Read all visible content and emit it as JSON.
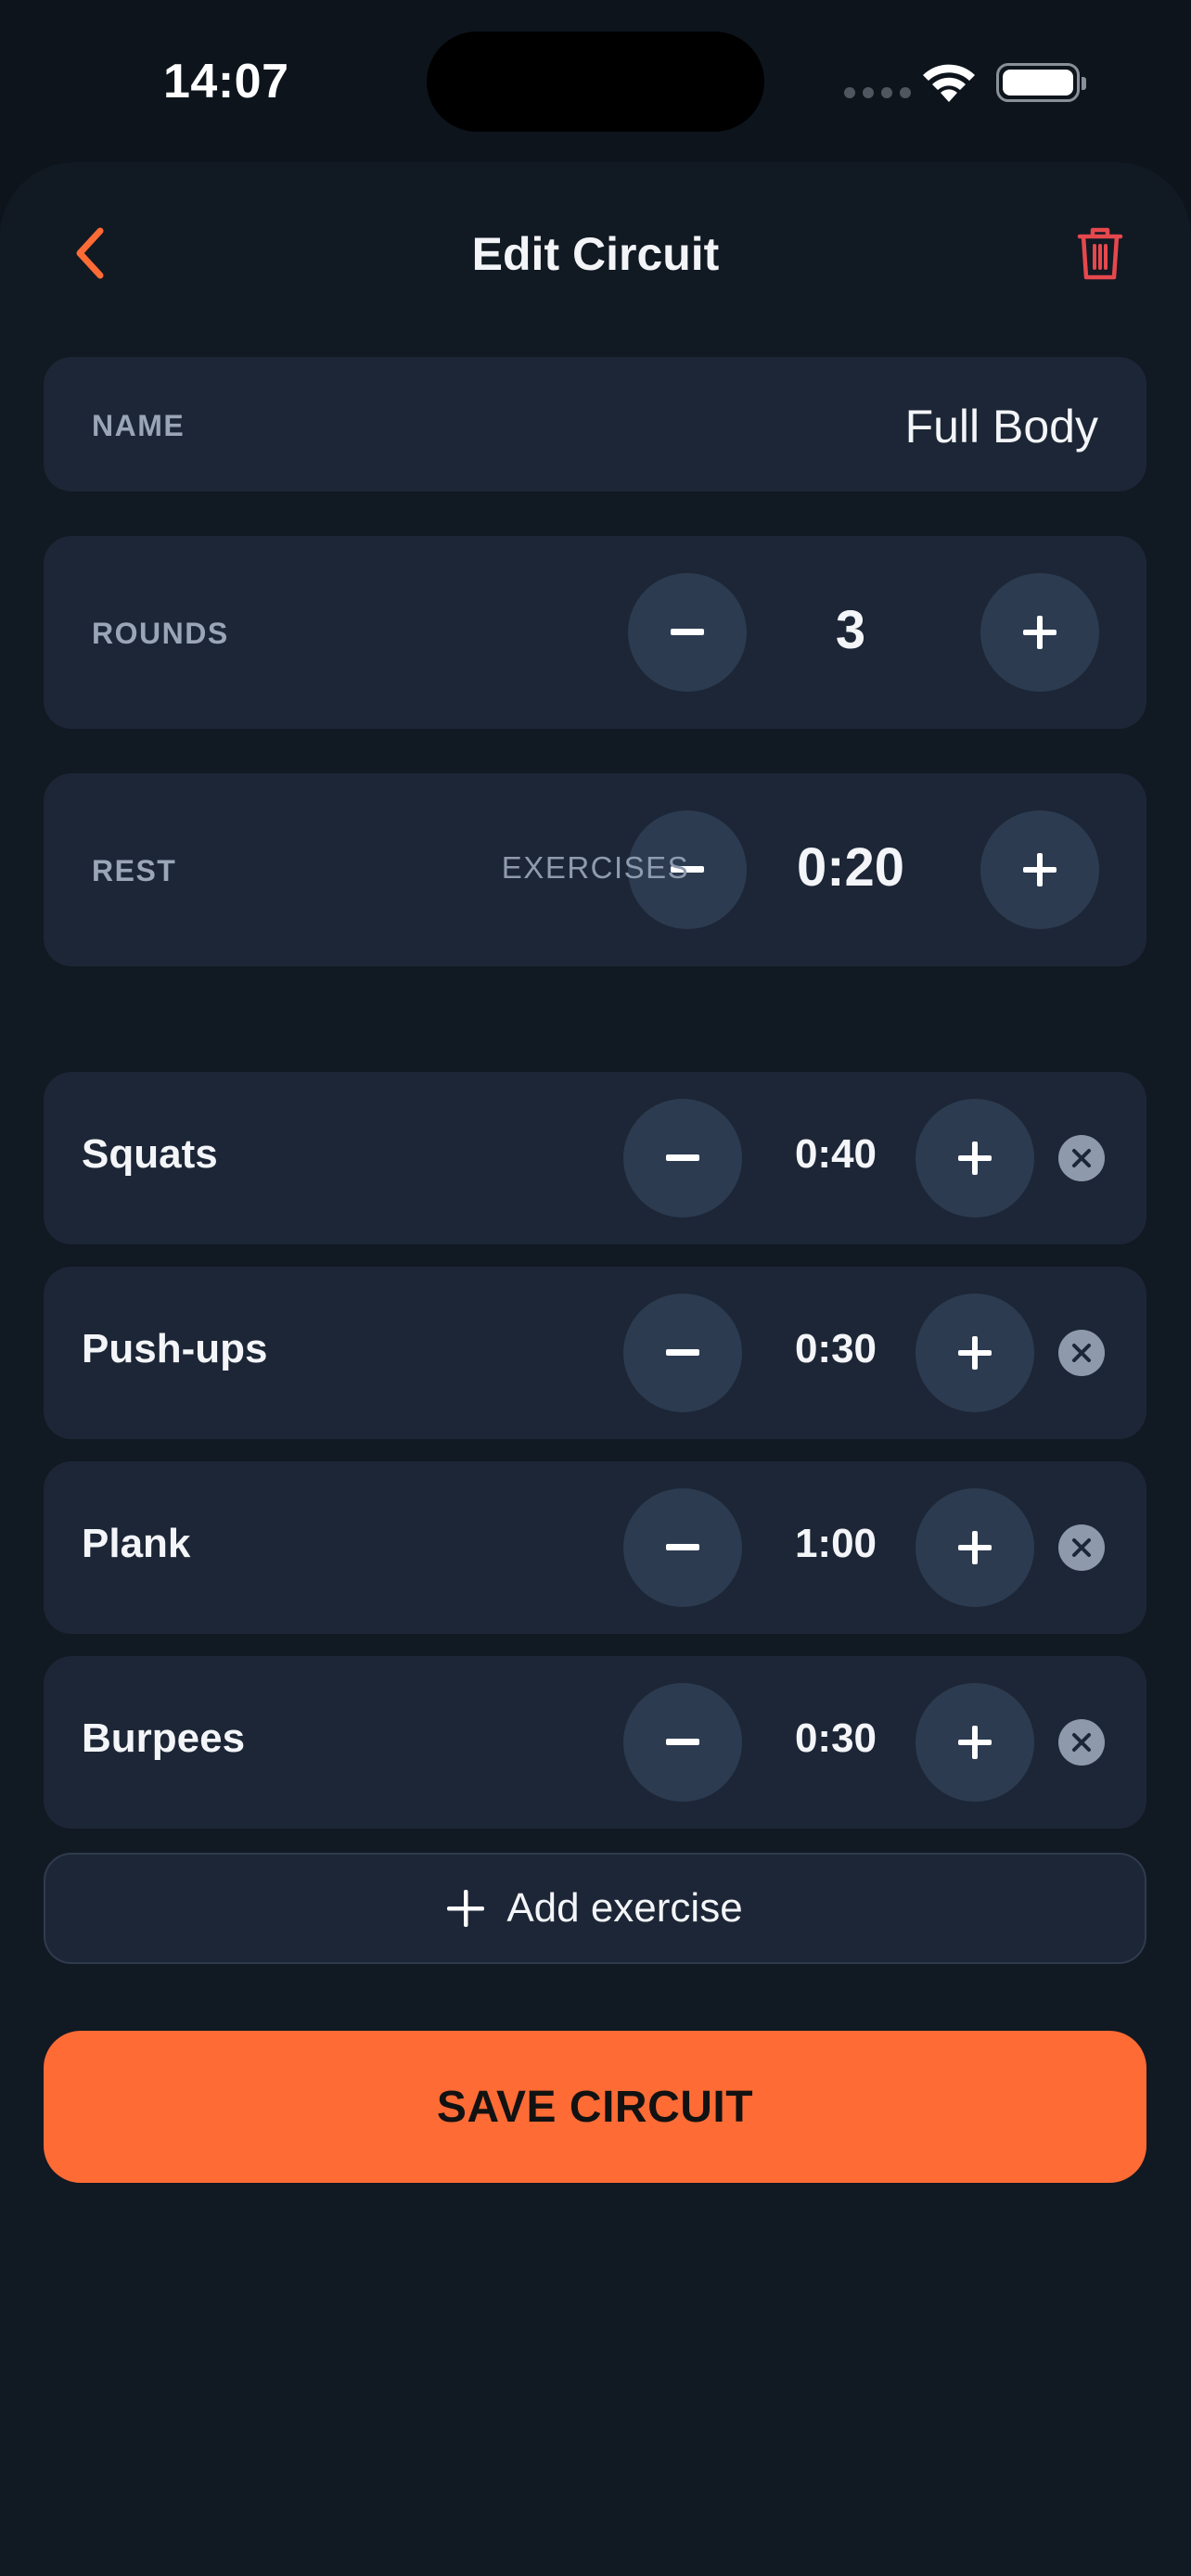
{
  "status": {
    "time": "14:07"
  },
  "nav": {
    "title": "Edit Circuit"
  },
  "name_field": {
    "label": "NAME",
    "value": "Full Body"
  },
  "rounds": {
    "label": "ROUNDS",
    "value": "3"
  },
  "rest": {
    "label": "REST",
    "value": "0:20"
  },
  "exercises_label": "EXERCISES",
  "exercises": [
    {
      "name": "Squats",
      "duration": "0:40"
    },
    {
      "name": "Push-ups",
      "duration": "0:30"
    },
    {
      "name": "Plank",
      "duration": "1:00"
    },
    {
      "name": "Burpees",
      "duration": "0:30"
    }
  ],
  "add_exercise_label": "Add exercise",
  "save_label": "SAVE CIRCUIT",
  "colors": {
    "accent": "#ff6b35",
    "delete": "#e5484d",
    "background": "#0d141c",
    "card": "#1c2636",
    "stepper_button": "#2c3b50"
  },
  "icons": {
    "back": "chevron-left-icon",
    "delete": "trash-icon",
    "decrement": "minus-icon",
    "increment": "plus-icon",
    "remove": "close-circle-icon",
    "add": "plus-icon"
  }
}
